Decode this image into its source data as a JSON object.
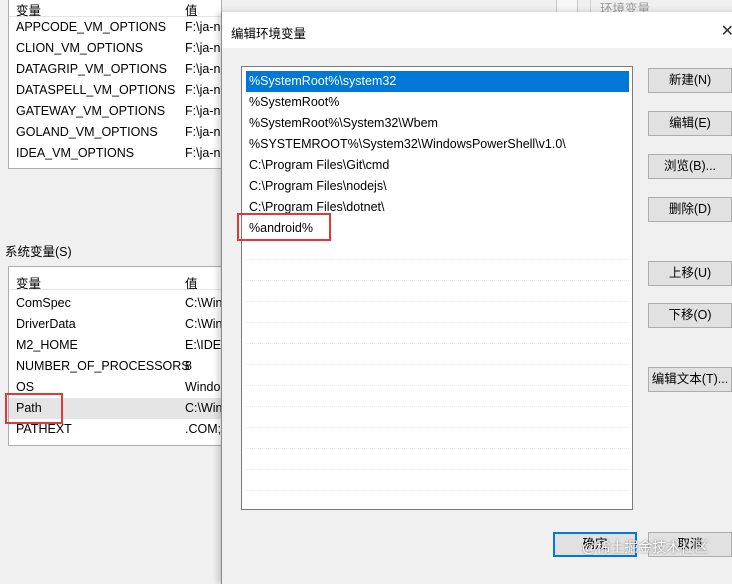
{
  "user_vars": {
    "col_var": "变量",
    "col_value": "值",
    "rows": [
      {
        "name": "APPCODE_VM_OPTIONS",
        "value": "F:\\ja-n"
      },
      {
        "name": "CLION_VM_OPTIONS",
        "value": "F:\\ja-n"
      },
      {
        "name": "DATAGRIP_VM_OPTIONS",
        "value": "F:\\ja-n"
      },
      {
        "name": "DATASPELL_VM_OPTIONS",
        "value": "F:\\ja-n"
      },
      {
        "name": "GATEWAY_VM_OPTIONS",
        "value": "F:\\ja-n"
      },
      {
        "name": "GOLAND_VM_OPTIONS",
        "value": "F:\\ja-n"
      },
      {
        "name": "IDEA_VM_OPTIONS",
        "value": "F:\\ja-n"
      }
    ]
  },
  "ghost_label": "环境变量",
  "sys_vars": {
    "label": "系统变量(S)",
    "col_var": "变量",
    "col_value": "值",
    "rows": [
      {
        "name": "ComSpec",
        "value": "C:\\Win"
      },
      {
        "name": "DriverData",
        "value": "C:\\Win"
      },
      {
        "name": "M2_HOME",
        "value": "E:\\IDE"
      },
      {
        "name": "NUMBER_OF_PROCESSORS",
        "value": "8"
      },
      {
        "name": "OS",
        "value": "Windo"
      },
      {
        "name": "Path",
        "value": "C:\\Win"
      },
      {
        "name": "PATHEXT",
        "value": ".COM;"
      }
    ]
  },
  "dialog": {
    "title": "编辑环境变量",
    "close": "✕",
    "paths": [
      "%SystemRoot%\\system32",
      "%SystemRoot%",
      "%SystemRoot%\\System32\\Wbem",
      "%SYSTEMROOT%\\System32\\WindowsPowerShell\\v1.0\\",
      "C:\\Program Files\\Git\\cmd",
      "C:\\Program Files\\nodejs\\",
      "C:\\Program Files\\dotnet\\",
      "%android%"
    ],
    "buttons": {
      "new": "新建(N)",
      "edit": "编辑(E)",
      "browse": "浏览(B)...",
      "delete": "删除(D)",
      "move_up": "上移(U)",
      "move_down": "下移(O)",
      "edit_text": "编辑文本(T)...",
      "ok": "确定",
      "cancel": "取消"
    }
  },
  "watermark": "@稀土掘金技术社区"
}
